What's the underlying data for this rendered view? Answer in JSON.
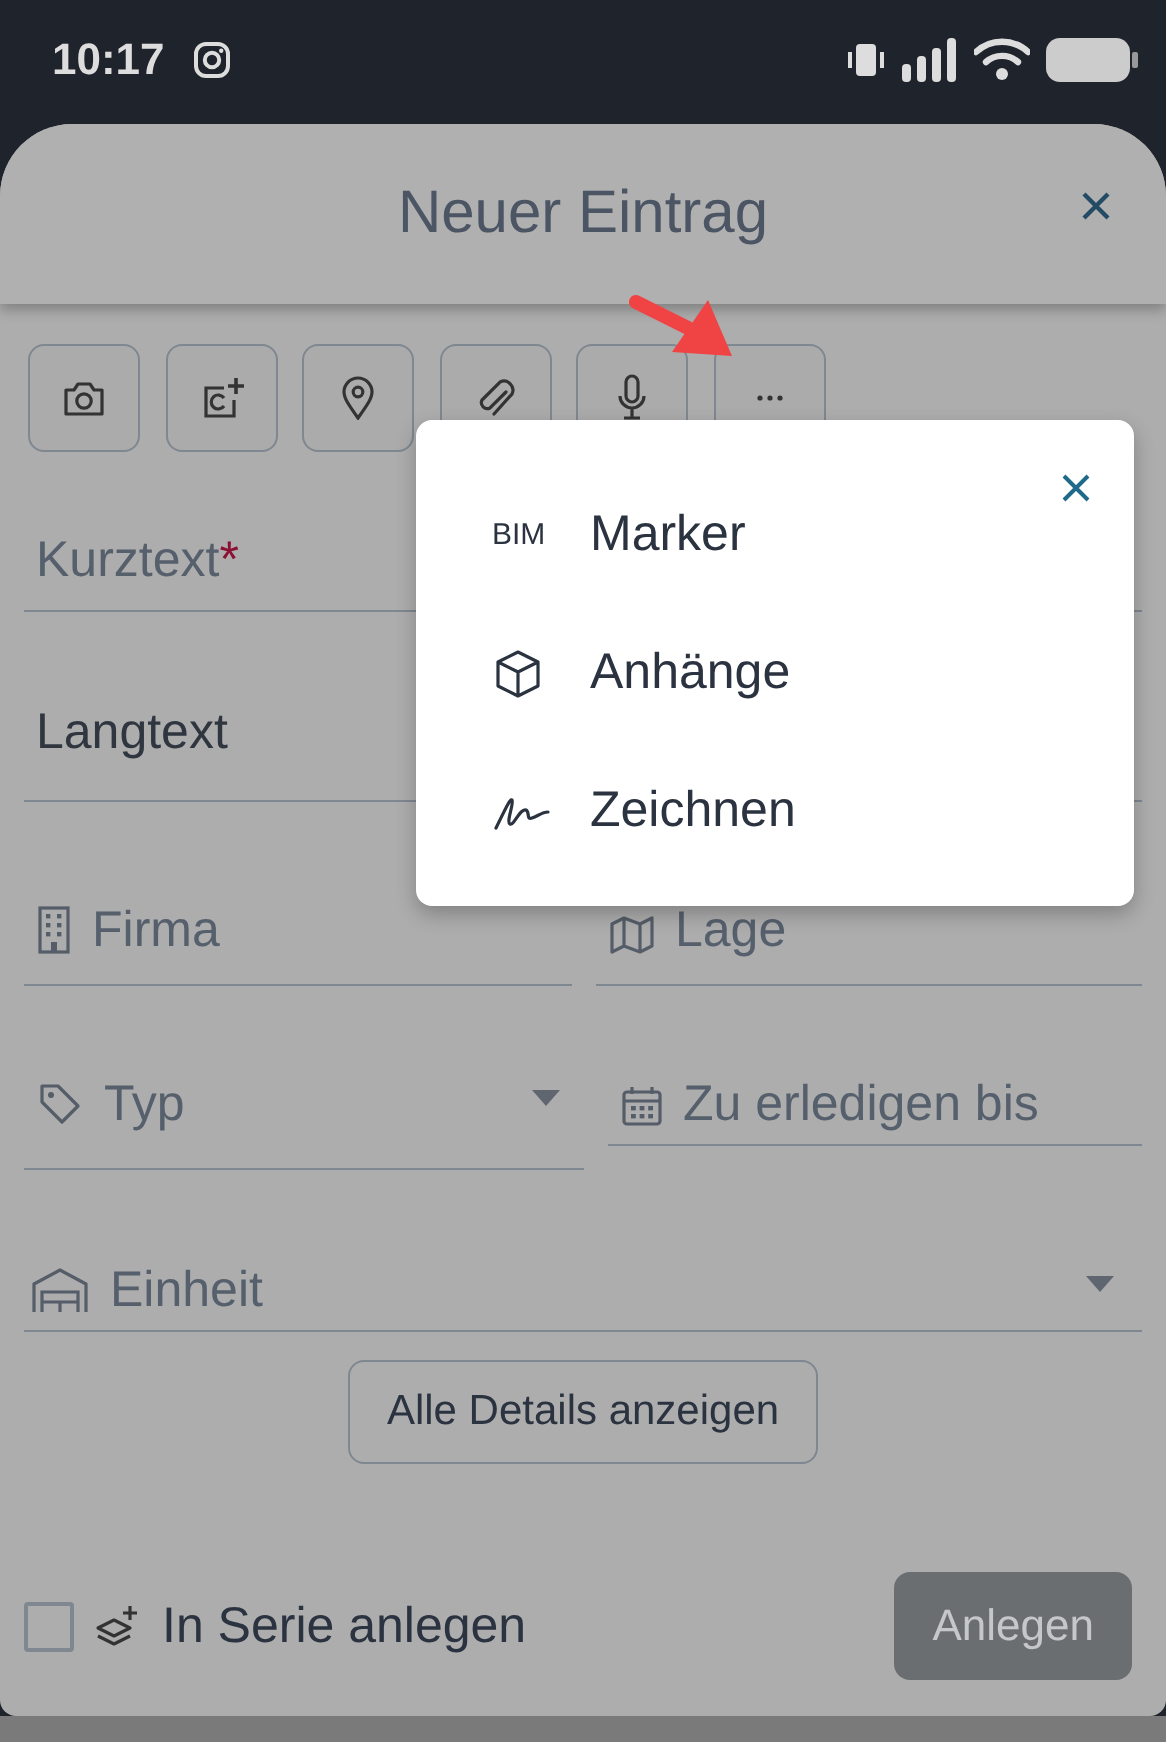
{
  "status_bar": {
    "time": "10:17"
  },
  "sheet": {
    "title": "Neuer Eintrag"
  },
  "form": {
    "kurztext": {
      "label": "Kurztext",
      "required_mark": "*"
    },
    "langtext": {
      "label": "Langtext"
    },
    "firma": {
      "label": "Firma"
    },
    "lage": {
      "label": "Lage"
    },
    "typ": {
      "label": "Typ"
    },
    "due_date": {
      "label": "Zu erledigen bis"
    },
    "einheit": {
      "label": "Einheit"
    }
  },
  "details_button": {
    "label": "Alle Details anzeigen"
  },
  "series": {
    "label": "In Serie anlegen",
    "checked": false
  },
  "create_button": {
    "label": "Anlegen",
    "disabled": true
  },
  "menu": {
    "items": [
      {
        "label": "Marker",
        "icon_text": "BIM"
      },
      {
        "label": "Anhänge"
      },
      {
        "label": "Zeichnen"
      }
    ]
  }
}
